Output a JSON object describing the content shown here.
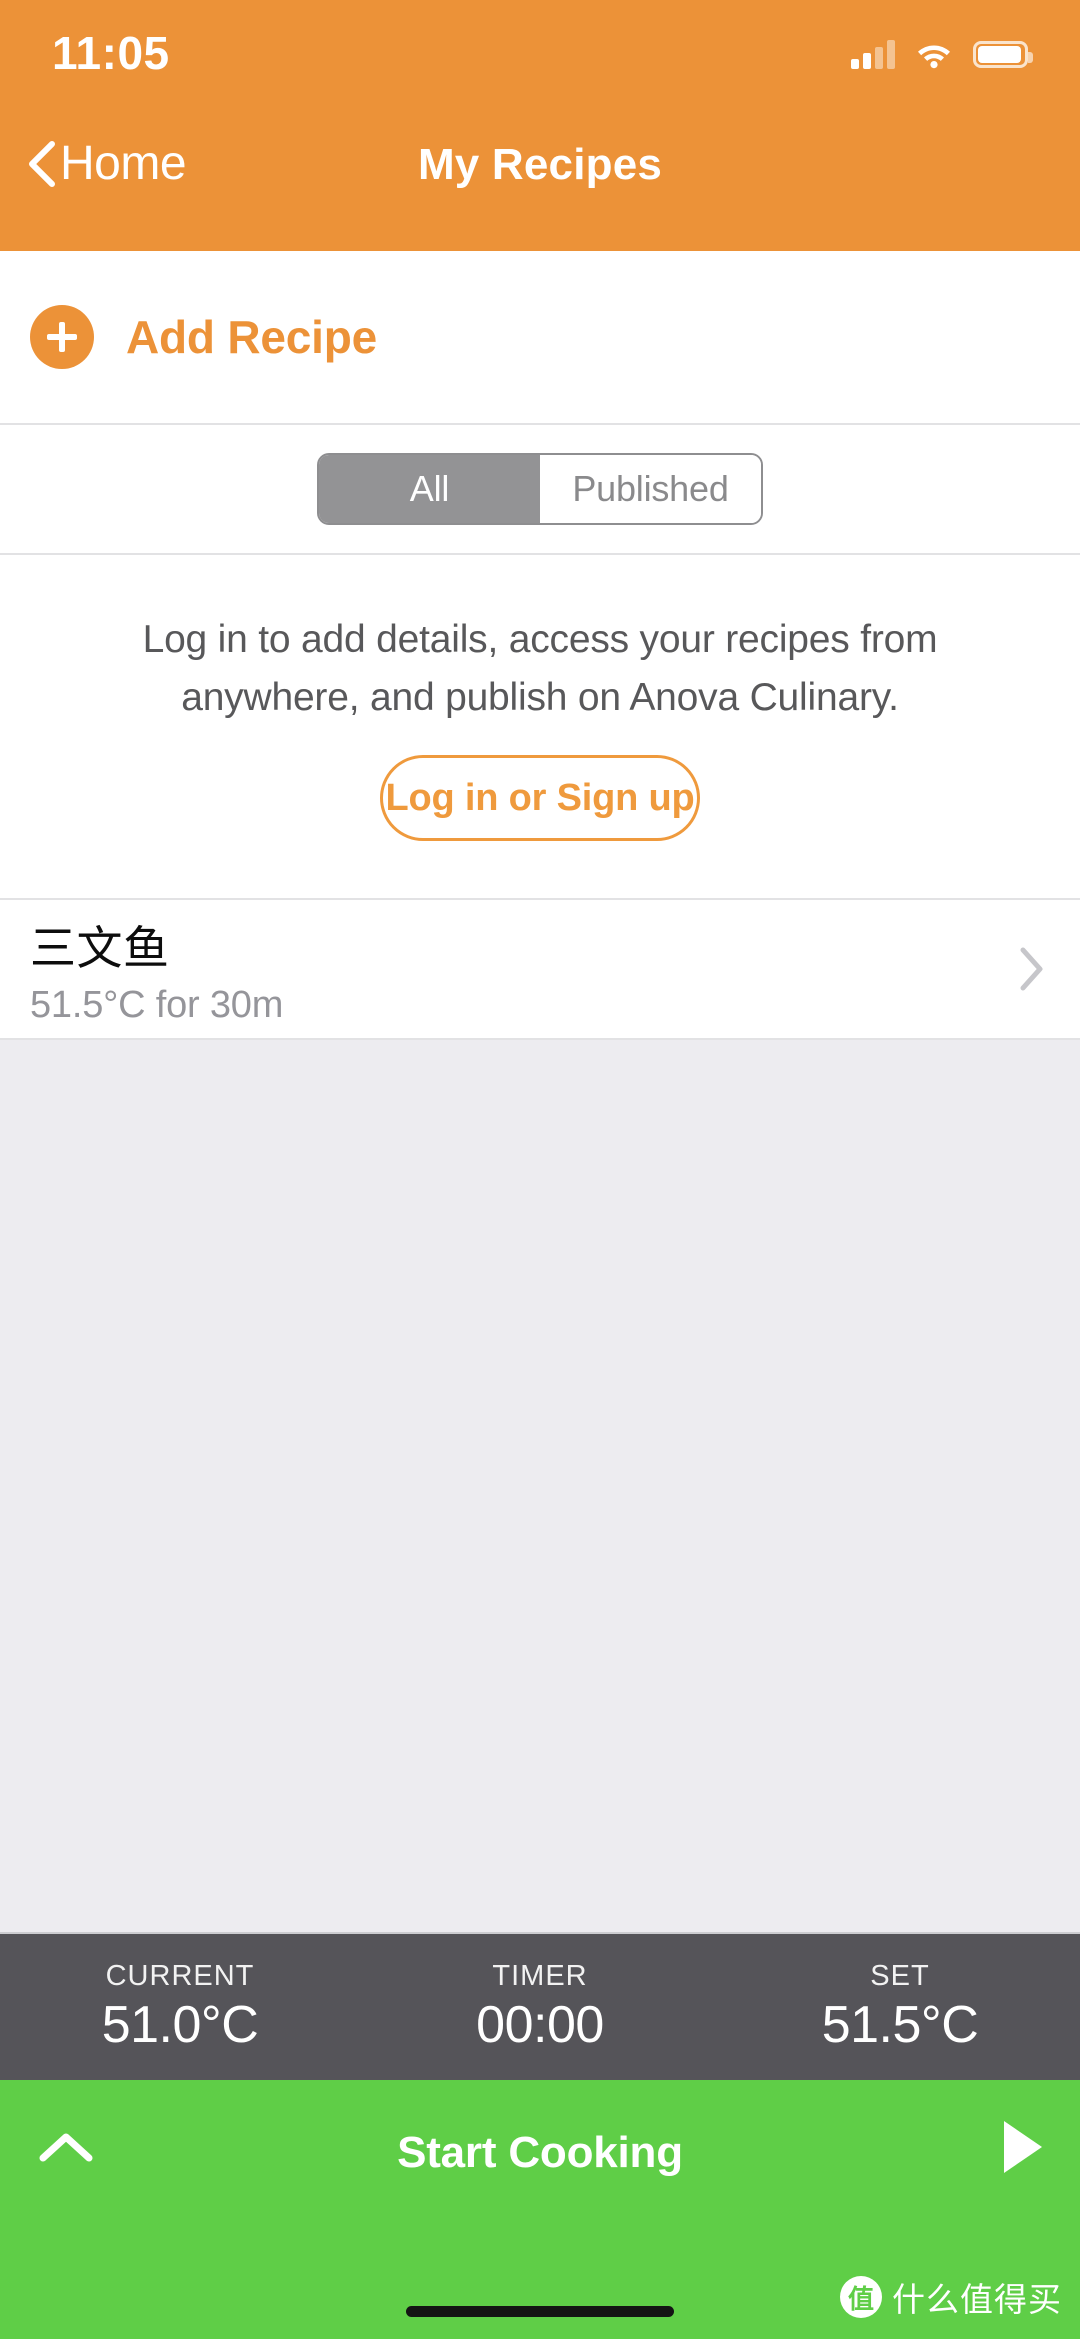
{
  "status_bar": {
    "time": "11:05",
    "signal_icon": "cellular-signal-icon",
    "wifi_icon": "wifi-icon",
    "battery_icon": "battery-icon"
  },
  "nav": {
    "back_label": "Home",
    "back_icon": "chevron-left-icon",
    "title": "My Recipes"
  },
  "add_recipe": {
    "label": "Add Recipe",
    "icon": "plus-icon"
  },
  "segmented": {
    "options": [
      {
        "label": "All",
        "selected": true
      },
      {
        "label": "Published",
        "selected": false
      }
    ]
  },
  "login_prompt": {
    "message": "Log in to add details, access your recipes from anywhere, and publish on Anova Culinary.",
    "button_label": "Log in or Sign up"
  },
  "recipes": [
    {
      "title": "三文鱼",
      "subtitle": "51.5°C for 30m",
      "chevron_icon": "chevron-right-icon"
    }
  ],
  "device_status": {
    "cells": [
      {
        "label": "CURRENT",
        "value": "51.0°C"
      },
      {
        "label": "TIMER",
        "value": "00:00"
      },
      {
        "label": "SET",
        "value": "51.5°C"
      }
    ]
  },
  "action_bar": {
    "expand_icon": "chevron-up-icon",
    "label": "Start Cooking",
    "play_icon": "play-triangle-icon"
  },
  "watermark": {
    "badge": "值",
    "text": "什么值得买"
  },
  "colors": {
    "header_orange": "#ec9238",
    "accent_orange": "#ef9a3d",
    "action_green": "#5fce47",
    "status_panel_gray": "#555459",
    "page_gray": "#edecf0"
  }
}
